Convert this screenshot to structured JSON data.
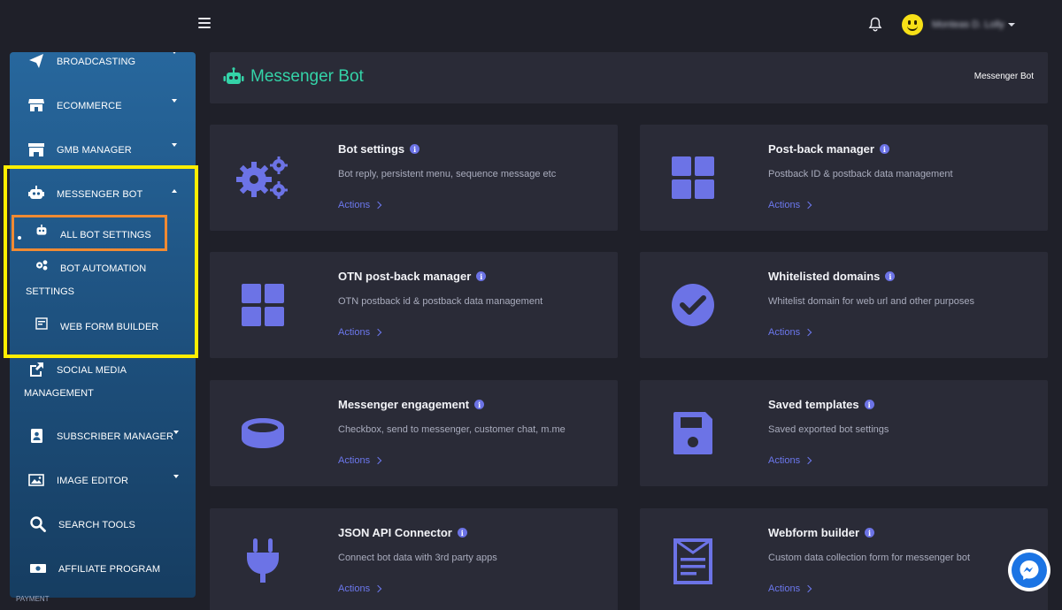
{
  "topbar": {
    "user_name": "Monteas D. Lolly"
  },
  "sidebar": {
    "items": [
      {
        "label": "BROADCASTING"
      },
      {
        "label": "ECOMMERCE"
      },
      {
        "label": "GMB MANAGER"
      },
      {
        "label": "MESSENGER BOT"
      },
      {
        "label": "SOCIAL MEDIA",
        "label2": "MANAGEMENT"
      },
      {
        "label": "SUBSCRIBER MANAGER"
      },
      {
        "label": "IMAGE EDITOR"
      },
      {
        "label": "SEARCH TOOLS"
      },
      {
        "label": "AFFILIATE PROGRAM"
      }
    ],
    "sub_items": [
      {
        "label": "ALL BOT SETTINGS"
      },
      {
        "label": "BOT AUTOMATION",
        "label2": "SETTINGS"
      },
      {
        "label": "WEB FORM BUILDER"
      }
    ],
    "partial_label": "PAYMENT"
  },
  "page": {
    "title": "Messenger Bot",
    "breadcrumb": "Messenger Bot"
  },
  "cards": [
    {
      "title": "Bot settings",
      "desc": "Bot reply, persistent menu, sequence message etc",
      "action": "Actions",
      "icon": "gears-icon"
    },
    {
      "title": "Post-back manager",
      "desc": "Postback ID & postback data management",
      "action": "Actions",
      "icon": "grid-icon"
    },
    {
      "title": "OTN post-back manager",
      "desc": "OTN postback id & postback data management",
      "action": "Actions",
      "icon": "grid-icon"
    },
    {
      "title": "Whitelisted domains",
      "desc": "Whitelist domain for web url and other purposes",
      "action": "Actions",
      "icon": "check-circle-icon"
    },
    {
      "title": "Messenger engagement",
      "desc": "Checkbox, send to messenger, customer chat, m.me",
      "action": "Actions",
      "icon": "ring-icon"
    },
    {
      "title": "Saved templates",
      "desc": "Saved exported bot settings",
      "action": "Actions",
      "icon": "floppy-disk-icon"
    },
    {
      "title": "JSON API Connector",
      "desc": "Connect bot data with 3rd party apps",
      "action": "Actions",
      "icon": "plug-icon"
    },
    {
      "title": "Webform builder",
      "desc": "Custom data collection form for messenger bot",
      "action": "Actions",
      "icon": "form-icon"
    }
  ],
  "colors": {
    "accent": "#6c78ee",
    "title_green": "#34d3a8",
    "highlight_yellow": "#ffee00",
    "highlight_orange": "#f08a33"
  }
}
